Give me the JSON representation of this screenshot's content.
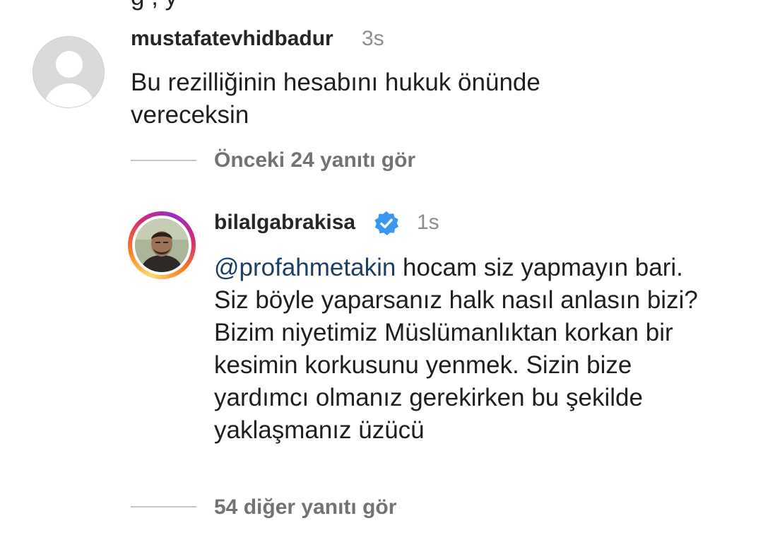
{
  "top_cut_text": "g   , y",
  "comment1": {
    "username": "mustafatevhidbadur",
    "time": "3s",
    "text": "Bu rezilliğinin hesabını hukuk önünde vereceksin"
  },
  "replies_prev": {
    "label": "Önceki 24 yanıtı gör"
  },
  "comment2": {
    "username": "bilalgabrakisa",
    "verified_icon": "verified-badge-icon",
    "time": "1s",
    "mention": "@profahmetakin",
    "text": " hocam siz yapmayın bari. Siz böyle yaparsanız halk nasıl anlasın bizi? Bizim niyetimiz Müslümanlıktan korkan bir kesimin korkusunu yenmek. Sizin bize yardımcı olmanız gerekirken bu şekilde yaklaşmanız üzücü"
  },
  "replies_more": {
    "label": "54 diğer yanıtı gör"
  },
  "colors": {
    "mention": "#1c3f66",
    "verified": "#3897f0",
    "muted": "#737373"
  }
}
